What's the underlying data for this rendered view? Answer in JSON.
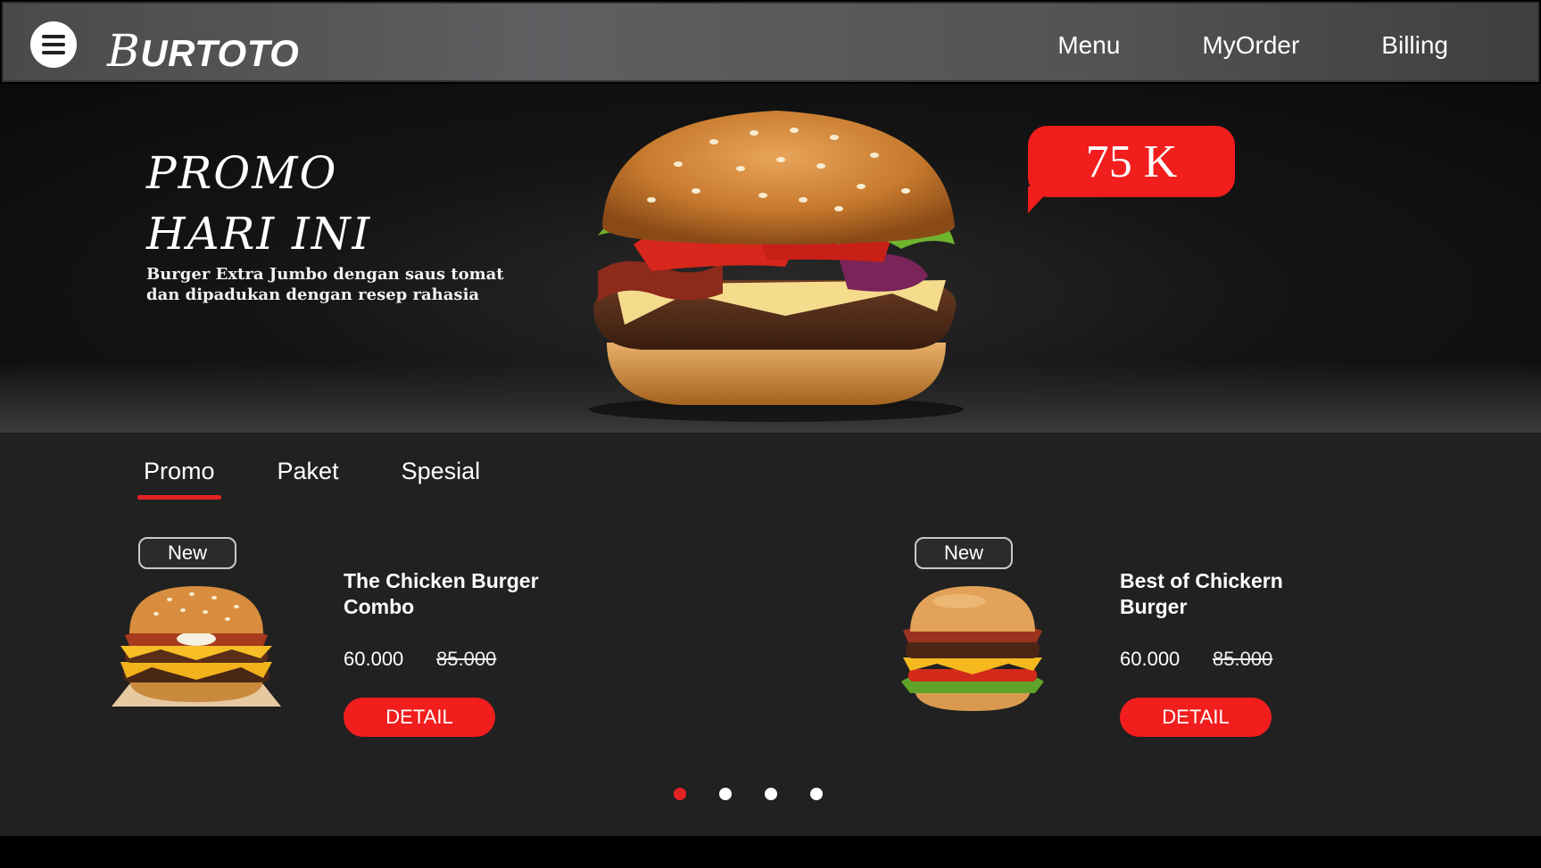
{
  "nav": {
    "logo_initial": "B",
    "logo_rest": "URTOTO",
    "links": [
      "Menu",
      "MyOrder",
      "Billing"
    ]
  },
  "hero": {
    "title_line1": "PROMO",
    "title_line2": "HARI INI",
    "description": "Burger Extra Jumbo dengan saus tomat dan dipadukan dengan resep rahasia",
    "price_tag": "75 K"
  },
  "tabs": [
    "Promo",
    "Paket",
    "Spesial"
  ],
  "active_tab": "Promo",
  "cards": [
    {
      "badge": "New",
      "title": "The Chicken Burger Combo",
      "price": "60.000",
      "old_price": "85.000",
      "button": "DETAIL"
    },
    {
      "badge": "New",
      "title": "Best of Chickern Burger",
      "price": "60.000",
      "old_price": "85.000",
      "button": "DETAIL"
    }
  ],
  "carousel": {
    "total_pages": 4,
    "active_page": 1
  },
  "colors": {
    "accent": "#f21d1d",
    "background": "#212121",
    "navbar": "#5a5a5c"
  }
}
